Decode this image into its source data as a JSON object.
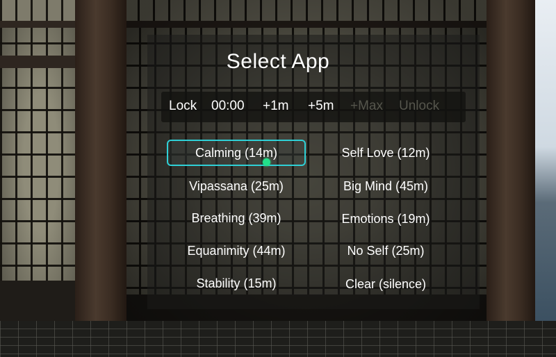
{
  "title": "Select App",
  "lock": {
    "label": "Lock",
    "time": "00:00",
    "buttons": [
      {
        "label": "+1m",
        "enabled": true
      },
      {
        "label": "+5m",
        "enabled": true
      },
      {
        "label": "+Max",
        "enabled": false
      },
      {
        "label": "Unlock",
        "enabled": false
      }
    ]
  },
  "apps": {
    "left": [
      {
        "label": "Calming (14m)",
        "selected": true
      },
      {
        "label": "Vipassana (25m)",
        "selected": false
      },
      {
        "label": "Breathing (39m)",
        "selected": false
      },
      {
        "label": "Equanimity (44m)",
        "selected": false
      },
      {
        "label": "Stability (15m)",
        "selected": false
      }
    ],
    "right": [
      {
        "label": "Self Love (12m)",
        "selected": false
      },
      {
        "label": "Big Mind (45m)",
        "selected": false
      },
      {
        "label": "Emotions (19m)",
        "selected": false
      },
      {
        "label": "No Self (25m)",
        "selected": false
      },
      {
        "label": "Clear (silence)",
        "selected": false
      }
    ]
  },
  "colors": {
    "selection_outline": "#2fd0d6",
    "pointer_dot": "#22e08a",
    "disabled_text": "#55554c"
  }
}
